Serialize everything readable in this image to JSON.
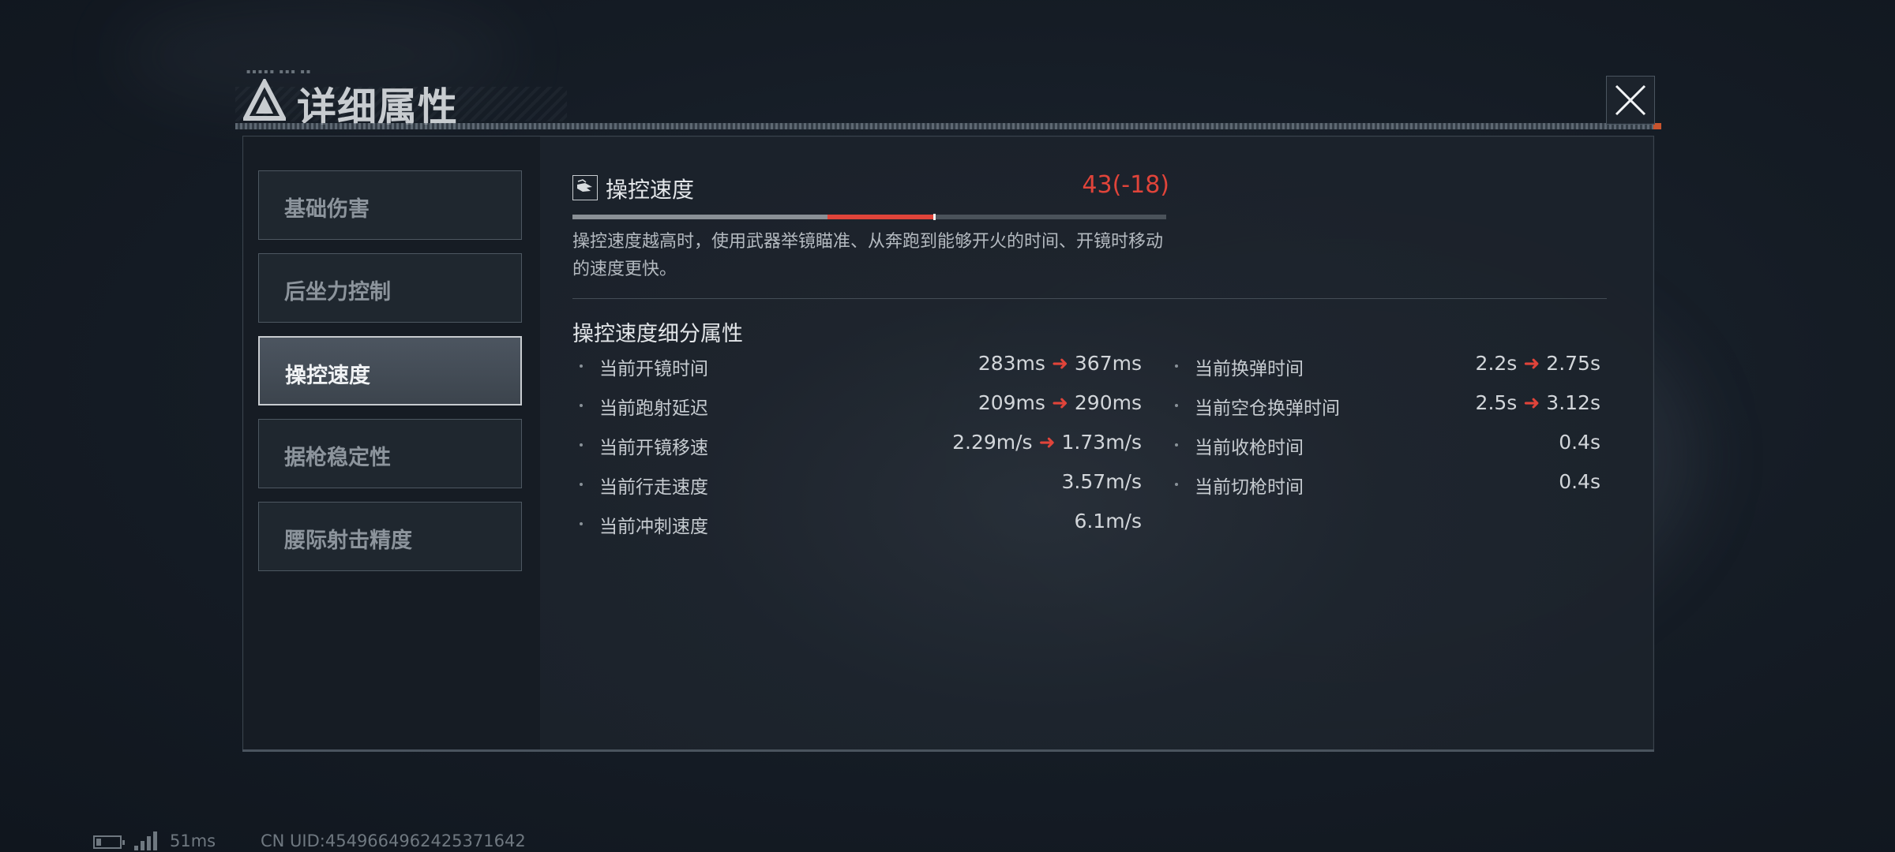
{
  "dialog": {
    "title": "详细属性",
    "colors": {
      "accent_red": "#e0443a",
      "active_tab_border": "#c8ccd0"
    }
  },
  "tabs": [
    {
      "label": "基础伤害",
      "active": false
    },
    {
      "label": "后坐力控制",
      "active": false
    },
    {
      "label": "操控速度",
      "active": true
    },
    {
      "label": "据枪稳定性",
      "active": false
    },
    {
      "label": "腰际射击精度",
      "active": false
    }
  ],
  "stat": {
    "icon": "hand-icon",
    "name": "操控速度",
    "value": "43(-18)",
    "bar": {
      "current": 43,
      "previous": 61,
      "max": 100
    },
    "description": "操控速度越高时，使用武器举镜瞄准、从奔跑到能够开火的时间、开镜时移动的速度更快。"
  },
  "breakdown": {
    "title": "操控速度细分属性",
    "left": [
      {
        "label": "当前开镜时间",
        "from": "283ms",
        "to": "367ms"
      },
      {
        "label": "当前跑射延迟",
        "from": "209ms",
        "to": "290ms"
      },
      {
        "label": "当前开镜移速",
        "from": "2.29m/s",
        "to": "1.73m/s"
      },
      {
        "label": "当前行走速度",
        "value": "3.57m/s"
      },
      {
        "label": "当前冲刺速度",
        "value": "6.1m/s"
      }
    ],
    "right": [
      {
        "label": "当前换弹时间",
        "from": "2.2s",
        "to": "2.75s"
      },
      {
        "label": "当前空仓换弹时间",
        "from": "2.5s",
        "to": "3.12s"
      },
      {
        "label": "当前收枪时间",
        "value": "0.4s"
      },
      {
        "label": "当前切枪时间",
        "value": "0.4s"
      }
    ]
  },
  "footer": {
    "ping": "51ms",
    "uid": "CN UID:4549664962425371642"
  }
}
